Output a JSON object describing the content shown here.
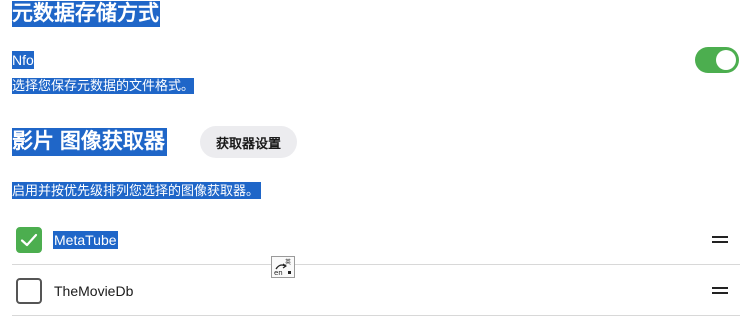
{
  "metadata_section": {
    "title": "元数据存储方式",
    "nfo_label": "Nfo",
    "nfo_description": "选择您保存元数据的文件格式。",
    "nfo_enabled": true
  },
  "image_fetchers_section": {
    "title": "影片 图像获取器",
    "settings_button": "获取器设置",
    "description": "启用并按优先级排列您选择的图像获取器。",
    "fetchers": [
      {
        "name": "MetaTube",
        "enabled": true
      },
      {
        "name": "TheMovieDb",
        "enabled": false
      }
    ]
  },
  "icons": {
    "toggle": "toggle-switch",
    "checked": "checkmark-icon",
    "drag": "drag-handle-icon",
    "ime": "ime-language-icon"
  },
  "colors": {
    "accent_green": "#4cae4f",
    "selection": "#1f66c8"
  }
}
